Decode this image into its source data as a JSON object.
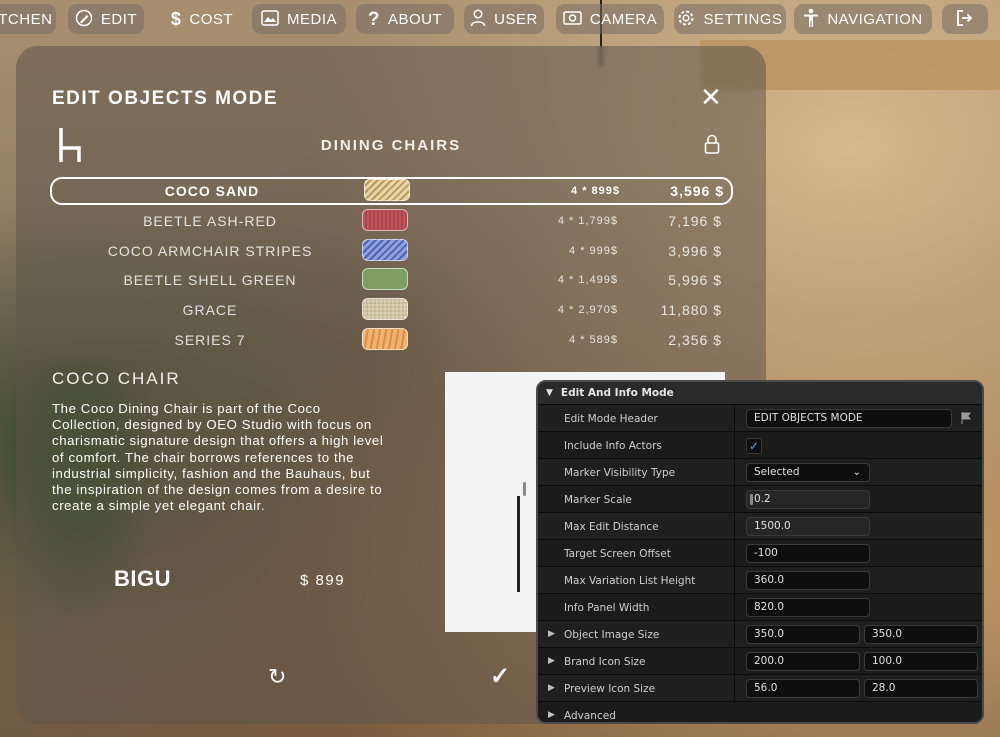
{
  "nav": [
    {
      "label": "ITCHEN",
      "icon": ""
    },
    {
      "label": "EDIT",
      "icon": "edit-icon"
    },
    {
      "label": "COST",
      "icon": "dollar-icon"
    },
    {
      "label": "MEDIA",
      "icon": "image-icon"
    },
    {
      "label": "ABOUT",
      "icon": "question-icon"
    },
    {
      "label": "USER",
      "icon": "user-icon"
    },
    {
      "label": "CAMERA",
      "icon": "camera-icon"
    },
    {
      "label": "SETTINGS",
      "icon": "gear-icon"
    },
    {
      "label": "NAVIGATION",
      "icon": "person-icon"
    },
    {
      "label": "",
      "icon": "logout-icon"
    }
  ],
  "panel": {
    "title": "EDIT OBJECTS MODE",
    "category": "DINING CHAIRS",
    "variants": [
      {
        "name": "COCO SAND",
        "qty": "4 * 899$",
        "total": "3,596 $",
        "selected": true,
        "swatch": "#d9c28e"
      },
      {
        "name": "BEETLE ASH-RED",
        "qty": "4 * 1,799$",
        "total": "7,196 $",
        "selected": false,
        "swatch": "#c0555b"
      },
      {
        "name": "COCO ARMCHAIR STRIPES",
        "qty": "4 * 999$",
        "total": "3,996 $",
        "selected": false,
        "swatch": "#6f82c9"
      },
      {
        "name": "BEETLE SHELL GREEN",
        "qty": "4 * 1,499$",
        "total": "5,996 $",
        "selected": false,
        "swatch": "#7f9e63"
      },
      {
        "name": "GRACE",
        "qty": "4 * 2,970$",
        "total": "11,880 $",
        "selected": false,
        "swatch": "#cfc3a6"
      },
      {
        "name": "SERIES 7",
        "qty": "4 * 589$",
        "total": "2,356 $",
        "selected": false,
        "swatch": "#e7a566"
      }
    ],
    "description_title": "COCO CHAIR",
    "description": "The Coco Dining Chair is part of the Coco Collection, designed by OEO Studio with focus on charismatic signature design that offers a high level of comfort. The chair borrows references to the industrial simplicity, fashion and the Bauhaus, but the inspiration of the design comes from a desire to create a simple yet elegant chair.",
    "brand": "BIGU",
    "price": "$ 899"
  },
  "details": {
    "header": "Edit And Info Mode",
    "rows": {
      "edit_mode_header": {
        "label": "Edit Mode Header",
        "value": "EDIT OBJECTS MODE"
      },
      "include_info_actors": {
        "label": "Include Info Actors",
        "checked": true
      },
      "marker_visibility_type": {
        "label": "Marker Visibility Type",
        "value": "Selected"
      },
      "marker_scale": {
        "label": "Marker Scale",
        "value": "0.2"
      },
      "max_edit_distance": {
        "label": "Max Edit Distance",
        "value": "1500.0"
      },
      "target_screen_offset": {
        "label": "Target Screen Offset",
        "value": "-100"
      },
      "max_variation_list_height": {
        "label": "Max Variation List Height",
        "value": "360.0"
      },
      "info_panel_width": {
        "label": "Info Panel Width",
        "value": "820.0"
      },
      "object_image_size": {
        "label": "Object Image Size",
        "x": "350.0",
        "y": "350.0"
      },
      "brand_icon_size": {
        "label": "Brand Icon Size",
        "x": "200.0",
        "y": "100.0"
      },
      "preview_icon_size": {
        "label": "Preview Icon Size",
        "x": "56.0",
        "y": "28.0"
      },
      "advanced": {
        "label": "Advanced"
      }
    }
  }
}
